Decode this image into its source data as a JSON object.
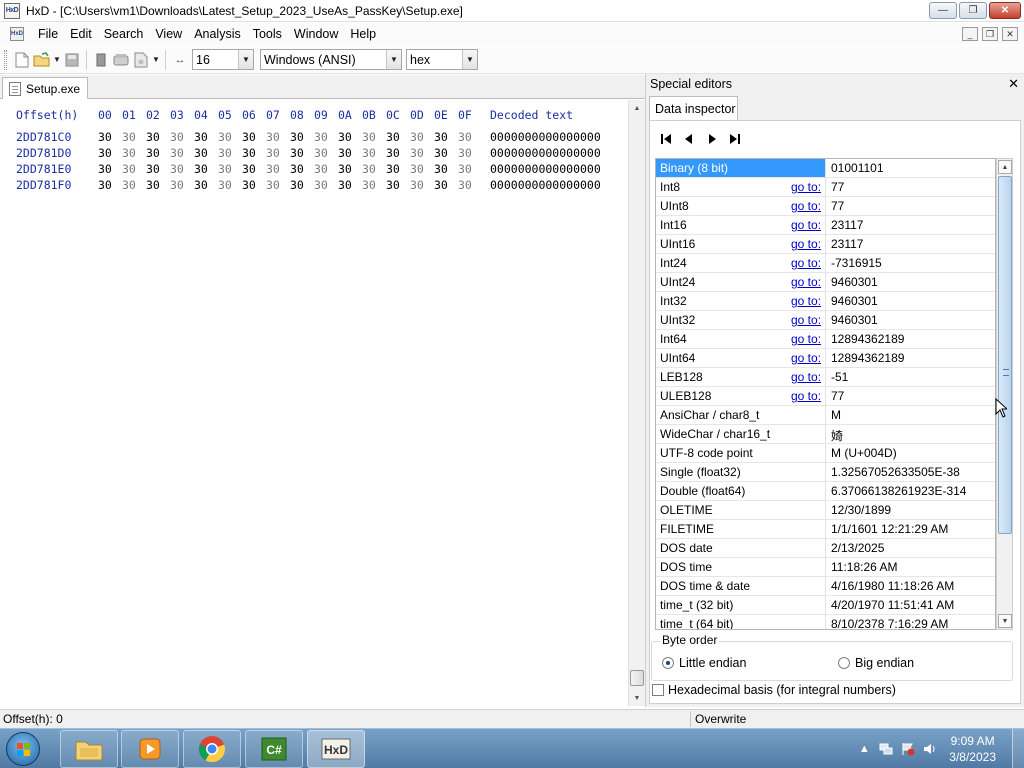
{
  "window": {
    "title": "HxD - [C:\\Users\\vm1\\Downloads\\Latest_Setup_2023_UseAs_PassKey\\Setup.exe]",
    "app_icon_text": "HxD"
  },
  "menu": [
    "File",
    "Edit",
    "Search",
    "View",
    "Analysis",
    "Tools",
    "Window",
    "Help"
  ],
  "toolbar": {
    "bytes_per_row": "16",
    "charset": "Windows (ANSI)",
    "offset_base": "hex"
  },
  "editor": {
    "tab_label": "Setup.exe",
    "header_offset": "Offset(h)",
    "header_columns": [
      "00",
      "01",
      "02",
      "03",
      "04",
      "05",
      "06",
      "07",
      "08",
      "09",
      "0A",
      "0B",
      "0C",
      "0D",
      "0E",
      "0F"
    ],
    "header_decoded": "Decoded text",
    "rows": [
      {
        "offset": "2DD781C0",
        "bytes": [
          "30",
          "30",
          "30",
          "30",
          "30",
          "30",
          "30",
          "30",
          "30",
          "30",
          "30",
          "30",
          "30",
          "30",
          "30",
          "30"
        ],
        "decoded": "0000000000000000"
      },
      {
        "offset": "2DD781D0",
        "bytes": [
          "30",
          "30",
          "30",
          "30",
          "30",
          "30",
          "30",
          "30",
          "30",
          "30",
          "30",
          "30",
          "30",
          "30",
          "30",
          "30"
        ],
        "decoded": "0000000000000000"
      },
      {
        "offset": "2DD781E0",
        "bytes": [
          "30",
          "30",
          "30",
          "30",
          "30",
          "30",
          "30",
          "30",
          "30",
          "30",
          "30",
          "30",
          "30",
          "30",
          "30",
          "30"
        ],
        "decoded": "0000000000000000"
      },
      {
        "offset": "2DD781F0",
        "bytes": [
          "30",
          "30",
          "30",
          "30",
          "30",
          "30",
          "30",
          "30",
          "30",
          "30",
          "30",
          "30",
          "30",
          "30",
          "30",
          "30"
        ],
        "decoded": "0000000000000000"
      }
    ]
  },
  "special_editors": {
    "title": "Special editors",
    "close_glyph": "✕",
    "tab_label": "Data inspector",
    "goto_label": "go to:",
    "rows": [
      {
        "name": "Binary (8 bit)",
        "goto": false,
        "value": "01001101",
        "selected": true
      },
      {
        "name": "Int8",
        "goto": true,
        "value": "77"
      },
      {
        "name": "UInt8",
        "goto": true,
        "value": "77"
      },
      {
        "name": "Int16",
        "goto": true,
        "value": "23117"
      },
      {
        "name": "UInt16",
        "goto": true,
        "value": "23117"
      },
      {
        "name": "Int24",
        "goto": true,
        "value": "-7316915"
      },
      {
        "name": "UInt24",
        "goto": true,
        "value": "9460301"
      },
      {
        "name": "Int32",
        "goto": true,
        "value": "9460301"
      },
      {
        "name": "UInt32",
        "goto": true,
        "value": "9460301"
      },
      {
        "name": "Int64",
        "goto": true,
        "value": "12894362189"
      },
      {
        "name": "UInt64",
        "goto": true,
        "value": "12894362189"
      },
      {
        "name": "LEB128",
        "goto": true,
        "value": "-51"
      },
      {
        "name": "ULEB128",
        "goto": true,
        "value": "77"
      },
      {
        "name": "AnsiChar / char8_t",
        "goto": false,
        "value": "M"
      },
      {
        "name": "WideChar / char16_t",
        "goto": false,
        "value": "婍"
      },
      {
        "name": "UTF-8 code point",
        "goto": false,
        "value": "M (U+004D)"
      },
      {
        "name": "Single (float32)",
        "goto": false,
        "value": "1.32567052633505E-38"
      },
      {
        "name": "Double (float64)",
        "goto": false,
        "value": "6.37066138261923E-314"
      },
      {
        "name": "OLETIME",
        "goto": false,
        "value": "12/30/1899"
      },
      {
        "name": "FILETIME",
        "goto": false,
        "value": "1/1/1601 12:21:29 AM"
      },
      {
        "name": "DOS date",
        "goto": false,
        "value": "2/13/2025"
      },
      {
        "name": "DOS time",
        "goto": false,
        "value": "11:18:26 AM"
      },
      {
        "name": "DOS time & date",
        "goto": false,
        "value": "4/16/1980 11:18:26 AM"
      },
      {
        "name": "time_t (32 bit)",
        "goto": false,
        "value": "4/20/1970 11:51:41 AM"
      },
      {
        "name": "time_t (64 bit)",
        "goto": false,
        "value": "8/10/2378 7:16:29 AM"
      }
    ],
    "byte_order": {
      "legend": "Byte order",
      "little": "Little endian",
      "big": "Big endian",
      "selected": "little"
    },
    "hex_basis_label": "Hexadecimal basis (for integral numbers)",
    "hex_basis_checked": false
  },
  "status": {
    "offset": "Offset(h): 0",
    "mode": "Overwrite"
  },
  "taskbar": {
    "apps": [
      "explorer",
      "media-player",
      "chrome",
      "csharp-ide",
      "hxd"
    ],
    "time": "9:09 AM",
    "date": "3/8/2023"
  }
}
